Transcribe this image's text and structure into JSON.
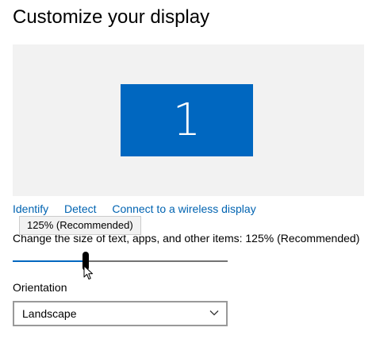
{
  "page": {
    "title": "Customize your display"
  },
  "display": {
    "monitor_number": "1",
    "monitor_color": "#0067c0",
    "background_color": "#f2f2f2"
  },
  "links": {
    "identify": "Identify",
    "detect": "Detect",
    "connect": "Connect to a wireless display"
  },
  "tooltip": {
    "text": "125% (Recommended)"
  },
  "scale": {
    "label": "Change the size of text, apps, and other items: 125% (Recommended)",
    "slider_level_fraction": 0.34,
    "accent_color": "#0067c0"
  },
  "orientation": {
    "label": "Orientation",
    "selected": "Landscape"
  }
}
